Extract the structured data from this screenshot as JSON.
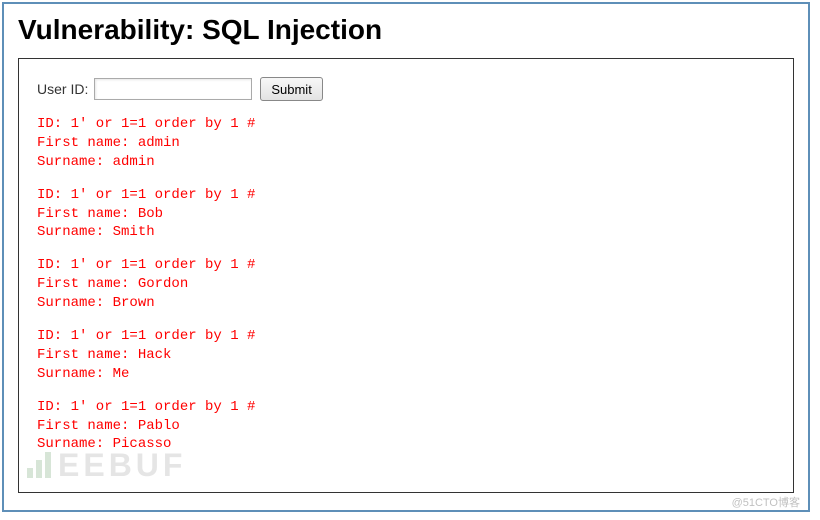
{
  "page": {
    "title": "Vulnerability: SQL Injection"
  },
  "form": {
    "label": "User ID:",
    "input_value": "",
    "submit_label": "Submit"
  },
  "results": [
    {
      "id": "1' or 1=1 order by 1 #",
      "first_name": "admin",
      "surname": "admin"
    },
    {
      "id": "1' or 1=1 order by 1 #",
      "first_name": "Bob",
      "surname": "Smith"
    },
    {
      "id": "1' or 1=1 order by 1 #",
      "first_name": "Gordon",
      "surname": "Brown"
    },
    {
      "id": "1' or 1=1 order by 1 #",
      "first_name": "Hack",
      "surname": "Me"
    },
    {
      "id": "1' or 1=1 order by 1 #",
      "first_name": "Pablo",
      "surname": "Picasso"
    }
  ],
  "labels": {
    "id": "ID: ",
    "first_name": "First name: ",
    "surname": "Surname: "
  },
  "watermark": {
    "logo_text": "EEBUF",
    "credit": "@51CTO博客"
  }
}
